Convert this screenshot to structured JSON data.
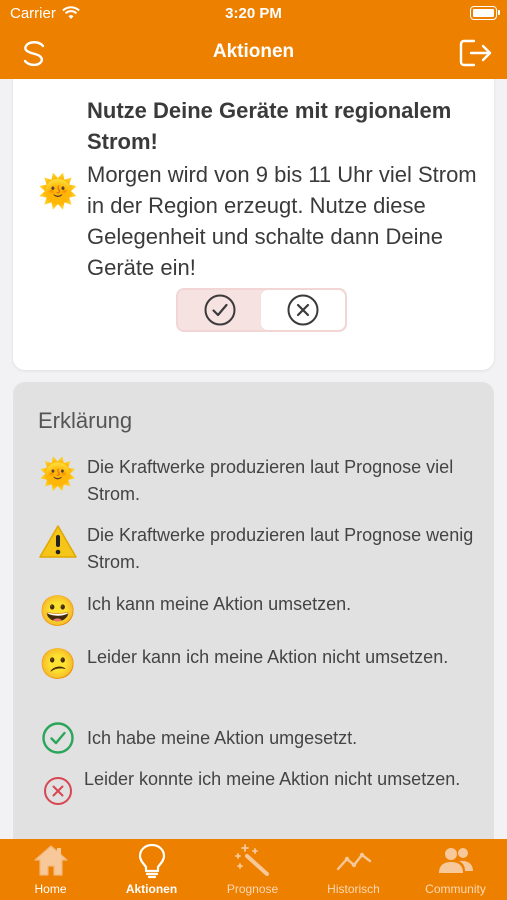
{
  "status_bar": {
    "carrier": "Carrier",
    "time": "3:20 PM"
  },
  "nav": {
    "title": "Aktionen"
  },
  "action_card": {
    "headline": "Nutze Deine Geräte mit regionalem Strom!",
    "body": "Morgen wird von 9 bis 11 Uhr viel Strom in der Region erzeugt. Nutze diese Gelegenheit und schalte dann Deine Geräte ein!",
    "emoji": "🌞"
  },
  "legend": {
    "heading": "Erklärung",
    "items": [
      {
        "icon": "sun-face-icon",
        "glyph": "🌞",
        "text": "Die Kraftwerke produzieren laut Prognose viel Strom."
      },
      {
        "icon": "warning-icon",
        "glyph": "⚠️",
        "text": "Die Kraftwerke produzieren laut Prognose wenig Strom."
      },
      {
        "icon": "grinning-face-icon",
        "glyph": "😀",
        "text": "Ich kann meine Aktion umsetzen."
      },
      {
        "icon": "neutral-face-icon",
        "glyph": "😕",
        "text": "Leider kann ich meine Aktion nicht umsetzen."
      },
      {
        "icon": "check-circle-icon",
        "glyph": "",
        "text": "Ich habe meine Aktion umgesetzt."
      },
      {
        "icon": "x-circle-icon",
        "glyph": "",
        "text": "Leider konnte ich meine Aktion nicht umsetzen."
      }
    ]
  },
  "tabs": [
    {
      "label": "Home",
      "icon": "home-icon"
    },
    {
      "label": "Aktionen",
      "icon": "lightbulb-icon",
      "active": true
    },
    {
      "label": "Prognose",
      "icon": "magic-wand-icon"
    },
    {
      "label": "Historisch",
      "icon": "line-chart-icon"
    },
    {
      "label": "Community",
      "icon": "users-icon"
    }
  ],
  "colors": {
    "brand": "#ee8000",
    "check": "#2aa55a",
    "cross": "#d8464f"
  }
}
